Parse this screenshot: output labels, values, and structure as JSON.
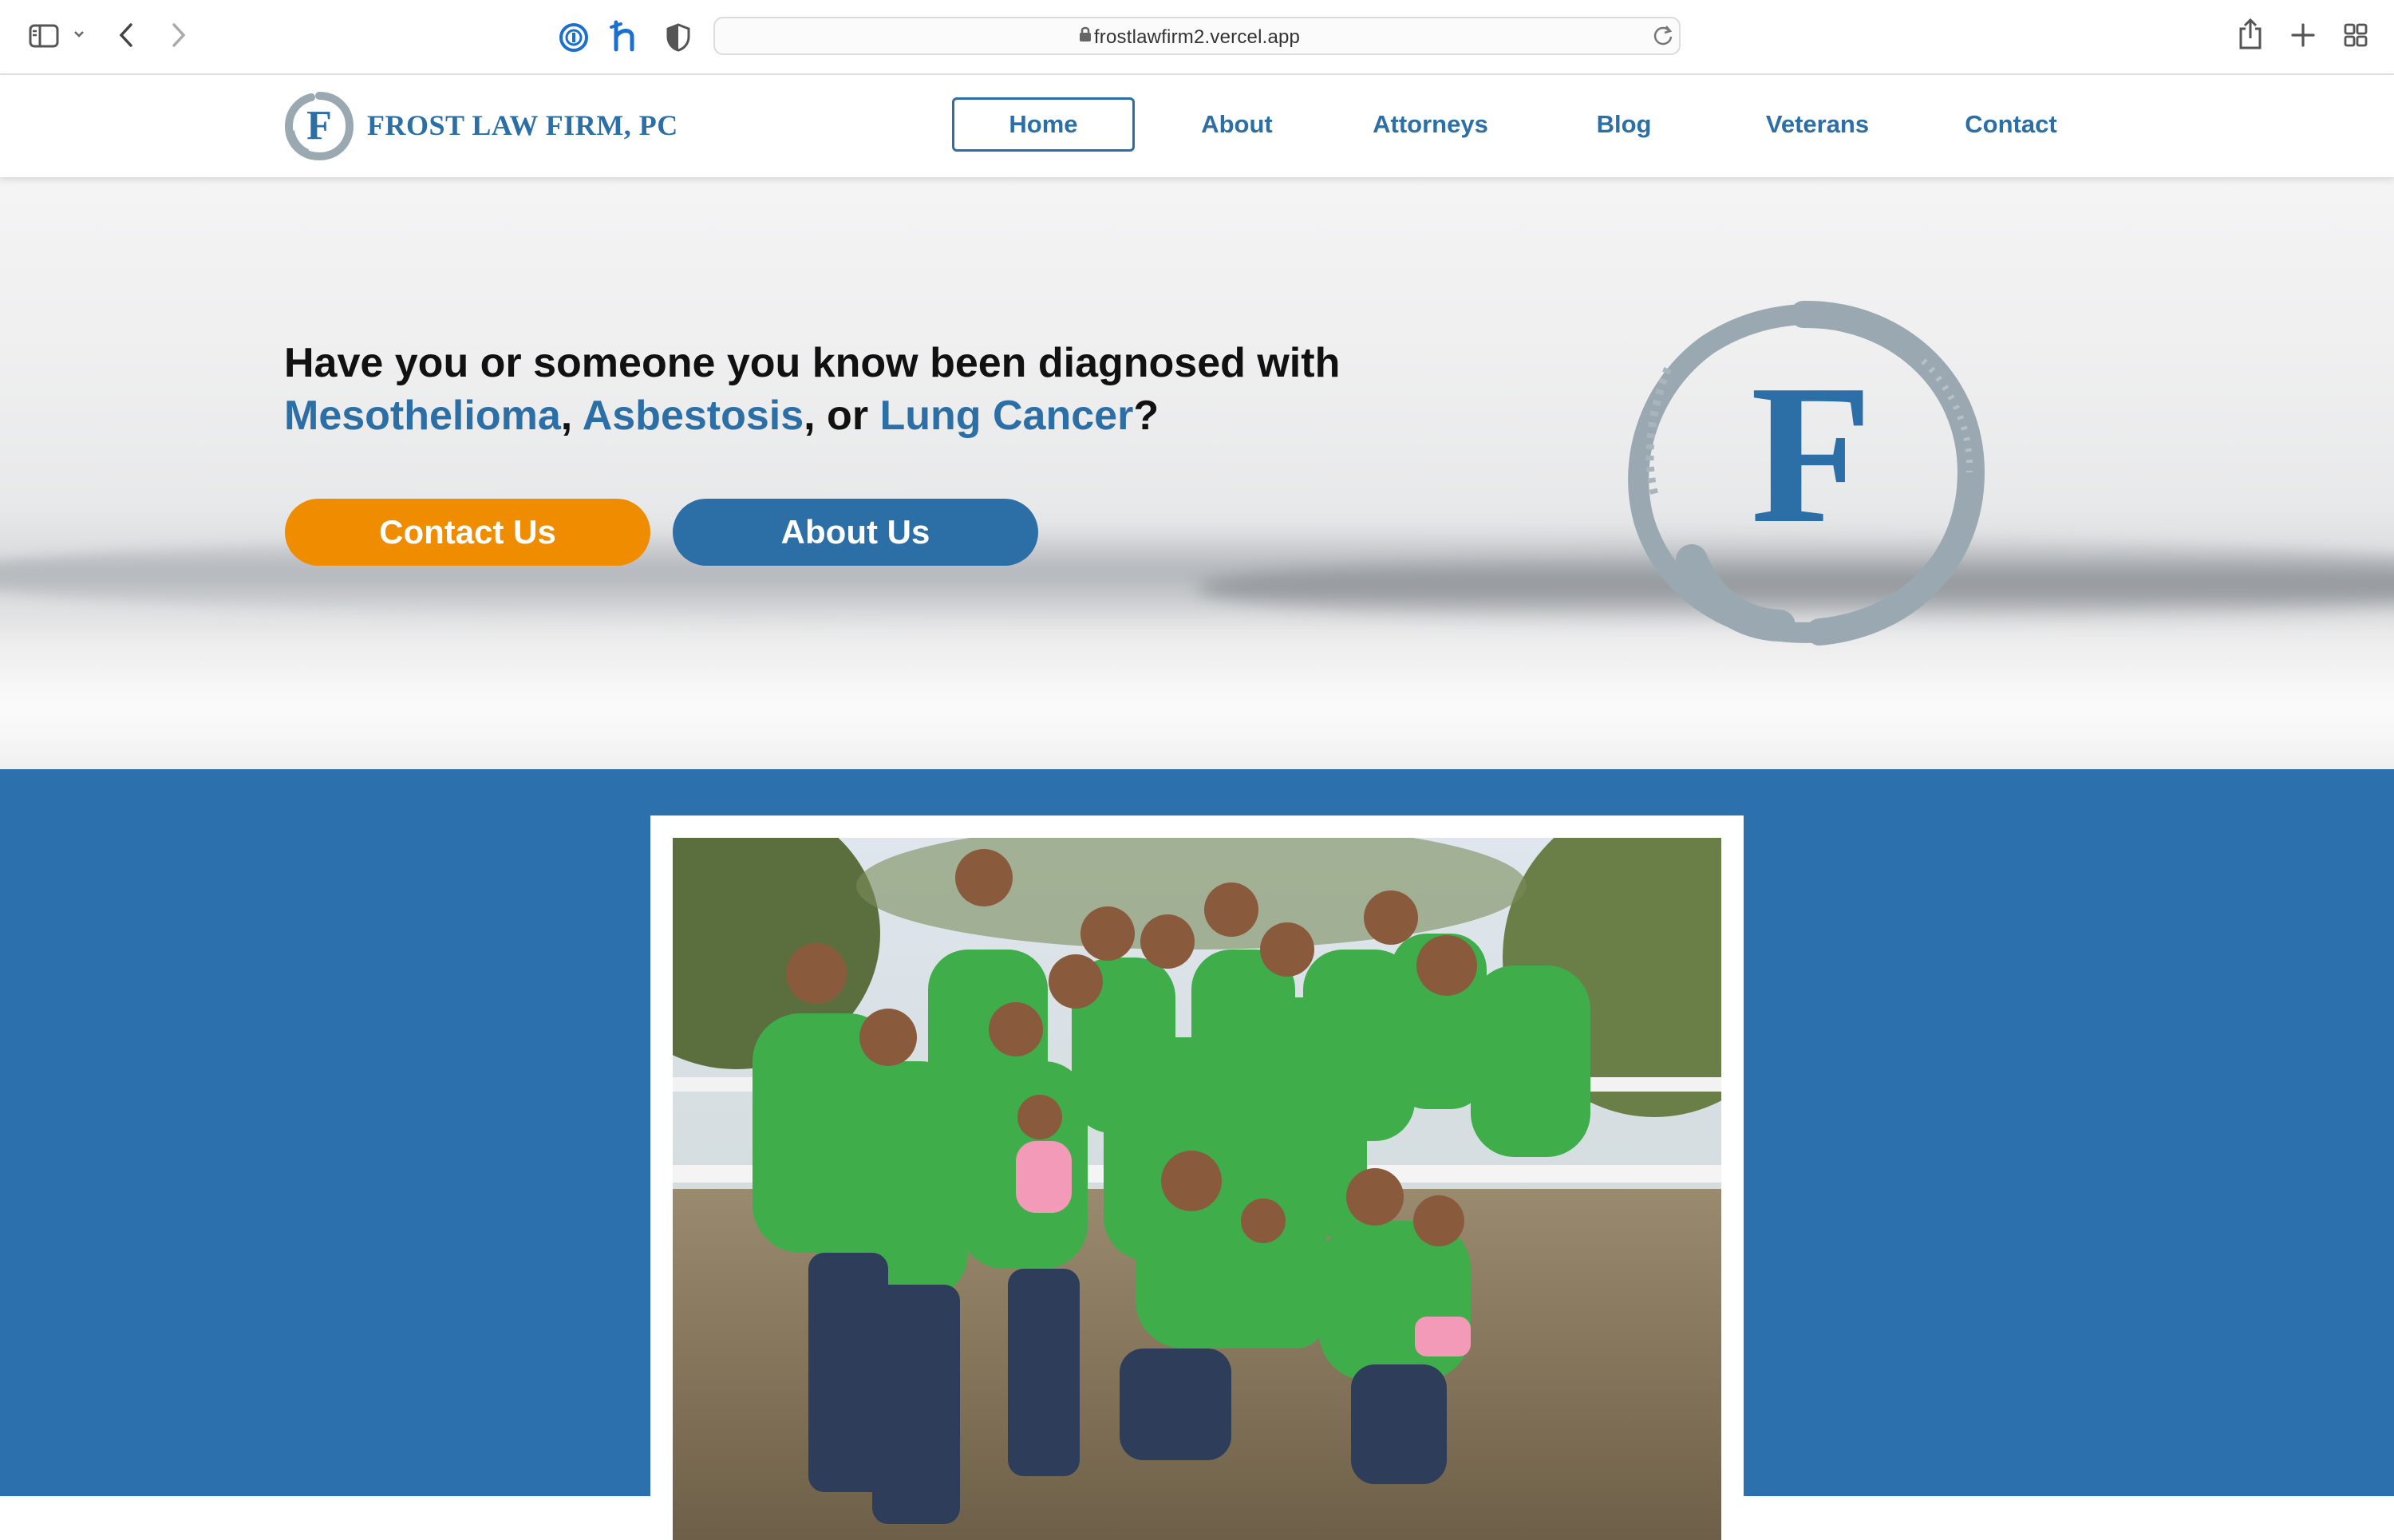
{
  "browser": {
    "url": "frostlawfirm2.vercel.app",
    "icons": [
      "sidebar-icon",
      "chevron-down-icon",
      "back-icon",
      "forward-icon",
      "password-manager-icon",
      "honey-extension-icon",
      "privacy-shield-icon",
      "lock-icon",
      "reload-icon",
      "share-icon",
      "new-tab-icon",
      "tab-overview-icon"
    ]
  },
  "header": {
    "logo_letter": "F",
    "logo_text": "FROST LAW FIRM, PC",
    "nav": [
      {
        "label": "Home",
        "active": true
      },
      {
        "label": "About",
        "active": false
      },
      {
        "label": "Attorneys",
        "active": false
      },
      {
        "label": "Blog",
        "active": false
      },
      {
        "label": "Veterans",
        "active": false
      },
      {
        "label": "Contact",
        "active": false
      }
    ]
  },
  "hero": {
    "line1": "Have you or someone you know been diagnosed with",
    "term1": "Mesothelioma",
    "sep1": ", ",
    "term2": "Asbestosis",
    "sep2": ", or ",
    "term3": "Lung Cancer",
    "end": "?",
    "contact_button": "Contact Us",
    "about_button": "About Us",
    "emblem_letter": "F"
  },
  "colors": {
    "brand_blue": "#2c6ea6",
    "section_blue": "#2c71ad",
    "accent_orange": "#ef8c00",
    "logo_gray": "#9aa8b1"
  }
}
